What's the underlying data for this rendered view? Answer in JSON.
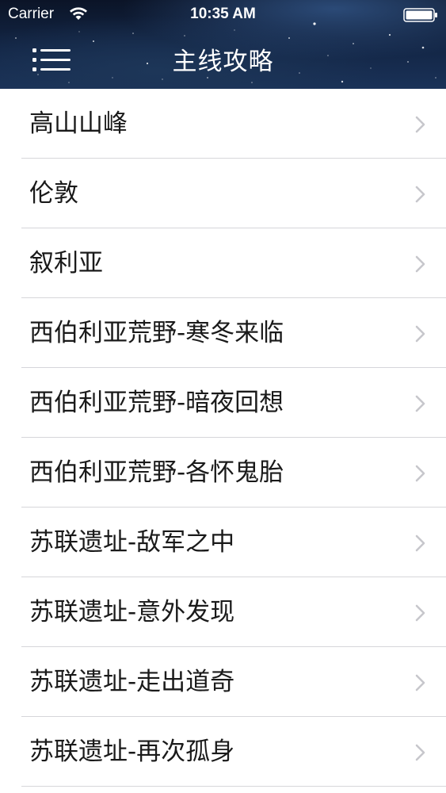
{
  "status_bar": {
    "carrier": "Carrier",
    "time": "10:35 AM",
    "wifi_icon": "wifi-icon",
    "battery_icon": "battery-icon"
  },
  "nav": {
    "title": "主线攻略",
    "menu_icon": "menu-icon"
  },
  "list": {
    "chevron_icon": "chevron-right-icon",
    "items": [
      {
        "label": "高山山峰"
      },
      {
        "label": "伦敦"
      },
      {
        "label": "叙利亚"
      },
      {
        "label": "西伯利亚荒野-寒冬来临"
      },
      {
        "label": "西伯利亚荒野-暗夜回想"
      },
      {
        "label": "西伯利亚荒野-各怀鬼胎"
      },
      {
        "label": "苏联遗址-敌军之中"
      },
      {
        "label": "苏联遗址-意外发现"
      },
      {
        "label": "苏联遗址-走出道奇"
      },
      {
        "label": "苏联遗址-再次孤身"
      }
    ]
  },
  "colors": {
    "header_top": "#0b1427",
    "header_bottom": "#1a3258",
    "separator": "#d6d6da",
    "chevron": "#c7c7cc",
    "text": "#1a1a1a"
  }
}
